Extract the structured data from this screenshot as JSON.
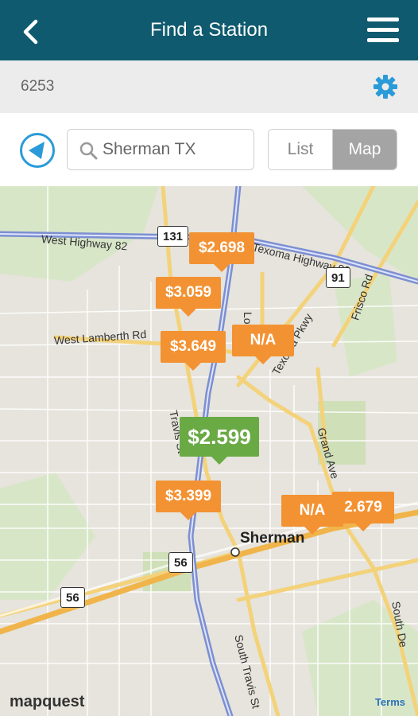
{
  "header": {
    "title": "Find a Station"
  },
  "subbar": {
    "zip": "6253"
  },
  "search": {
    "value": "Sherman TX"
  },
  "toggle": {
    "list_label": "List",
    "map_label": "Map",
    "active": "Map"
  },
  "map": {
    "city": "Sherman",
    "road_labels": {
      "west_highway_82": "West Highway 82",
      "texoma_highway_82": "Texoma Highway 82",
      "west_lamberth_rd": "West Lamberth Rd",
      "texoma_pkwy": "Texoma Pkwy",
      "loy_lake_rd": "Loy La",
      "frisco_rd": "Frisco Rd",
      "grand_ave": "Grand Ave",
      "travis_st": "Travis St",
      "south_travis_st": "South Travis St",
      "south_dewey": "South De"
    },
    "shields": {
      "hwy131": "131",
      "hwy91": "91",
      "hwy56a": "56",
      "hwy56b": "56"
    },
    "pins": {
      "p1": "$2.698",
      "p2": "$3.059",
      "p3": "$3.649",
      "p4": "N/A",
      "p5": "$2.599",
      "p6": "$3.399",
      "p7": "N/A",
      "p8": "2.679"
    },
    "attribution": "mapquest",
    "terms": "Terms"
  },
  "colors": {
    "header": "#0f5a6e",
    "accent": "#2a9bd8",
    "pin": "#f39233",
    "pin_best": "#6aaa45"
  }
}
